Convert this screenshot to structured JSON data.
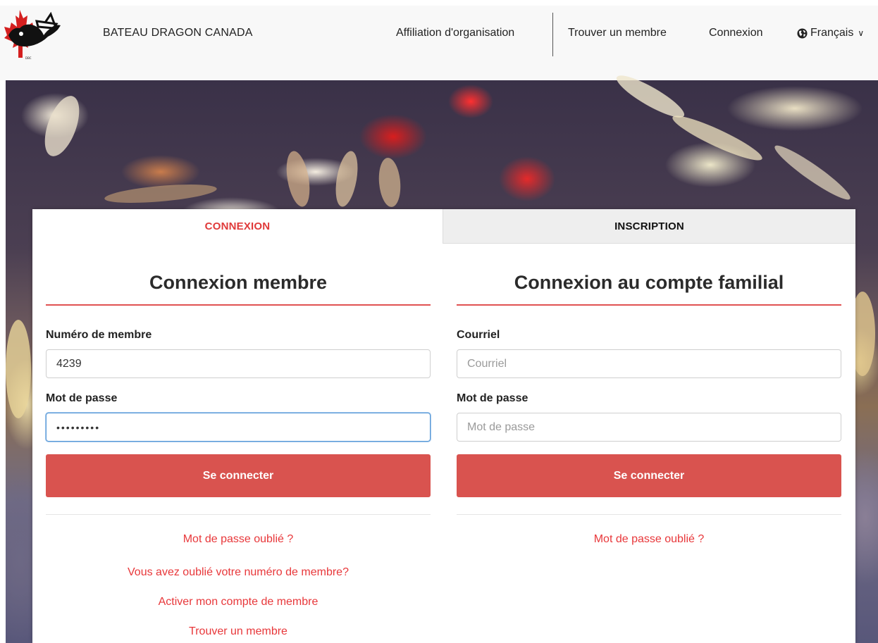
{
  "header": {
    "brand": "BATEAU DRAGON CANADA",
    "nav": {
      "affiliation": "Affiliation d'organisation",
      "find_member": "Trouver un membre",
      "login": "Connexion",
      "language": "Français"
    }
  },
  "tabs": {
    "login": "CONNEXION",
    "register": "INSCRIPTION",
    "active": "login"
  },
  "member_login": {
    "title": "Connexion membre",
    "member_number_label": "Numéro de membre",
    "member_number_value": "4239",
    "password_label": "Mot de passe",
    "password_value": "•••••••••",
    "submit": "Se connecter",
    "links": {
      "forgot_password": "Mot de passe oublié ?",
      "forgot_member_number": "Vous avez oublié votre numéro de membre?",
      "activate_account": "Activer mon compte de membre",
      "find_member": "Trouver un membre"
    }
  },
  "family_login": {
    "title": "Connexion au compte familial",
    "email_label": "Courriel",
    "email_placeholder": "Courriel",
    "password_label": "Mot de passe",
    "password_placeholder": "Mot de passe",
    "submit": "Se connecter",
    "links": {
      "forgot_password": "Mot de passe oublié ?"
    }
  },
  "colors": {
    "accent": "#d9534f",
    "link": "#e8373a",
    "rule": "#e05252",
    "focus": "#5b9bd8"
  }
}
